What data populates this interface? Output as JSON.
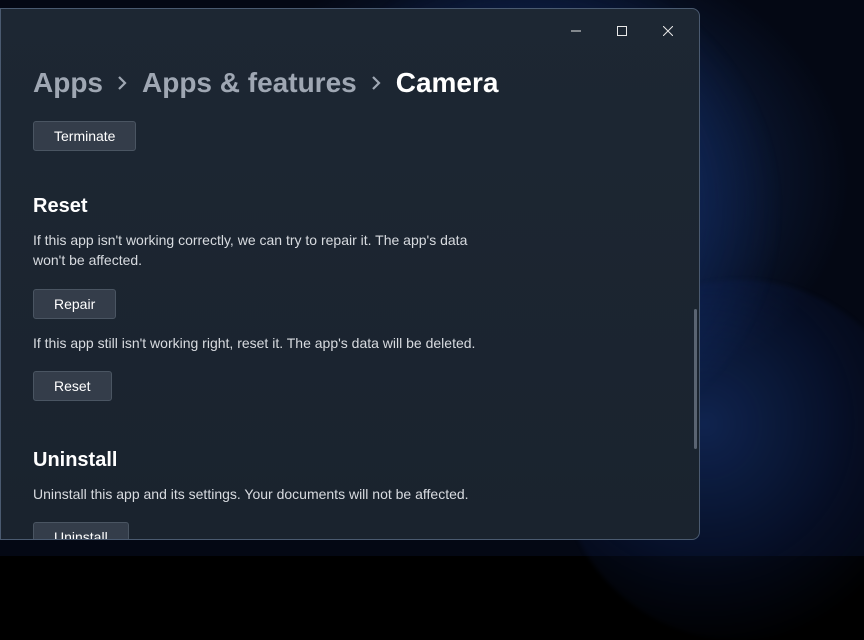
{
  "breadcrumb": {
    "items": [
      "Apps",
      "Apps & features",
      "Camera"
    ]
  },
  "terminate": {
    "button": "Terminate"
  },
  "reset": {
    "title": "Reset",
    "repair_desc": "If this app isn't working correctly, we can try to repair it. The app's data won't be affected.",
    "repair_button": "Repair",
    "reset_desc": "If this app still isn't working right, reset it. The app's data will be deleted.",
    "reset_button": "Reset"
  },
  "uninstall": {
    "title": "Uninstall",
    "desc": "Uninstall this app and its settings. Your documents will not be affected.",
    "button": "Uninstall"
  }
}
